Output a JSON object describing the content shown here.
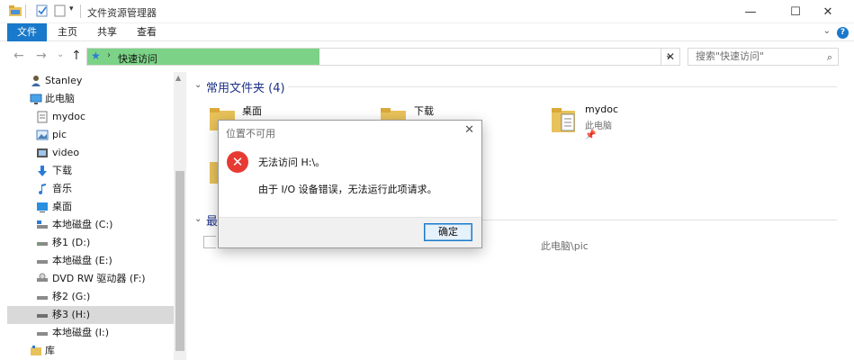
{
  "window": {
    "title": "文件资源管理器",
    "minimize": "—",
    "maximize": "☐",
    "close": "✕"
  },
  "ribbon": {
    "tabs": [
      "文件",
      "主页",
      "共享",
      "查看"
    ],
    "collapse": "⌄",
    "help": "?"
  },
  "nav": {
    "back": "←",
    "forward": "→",
    "recent": "⌄",
    "up": "↑"
  },
  "address": {
    "path": "快速访问",
    "separator": "›",
    "dropdown": "⌄",
    "clear": "✕"
  },
  "search": {
    "placeholder": "搜索\"快速访问\"",
    "icon": "⌕"
  },
  "sidebar": {
    "items": [
      {
        "label": "Stanley",
        "icon": "user-icon"
      },
      {
        "label": "此电脑",
        "icon": "computer-icon"
      },
      {
        "label": "mydoc",
        "icon": "document-icon"
      },
      {
        "label": "pic",
        "icon": "picture-icon"
      },
      {
        "label": "video",
        "icon": "video-icon"
      },
      {
        "label": "下载",
        "icon": "download-icon"
      },
      {
        "label": "音乐",
        "icon": "music-icon"
      },
      {
        "label": "桌面",
        "icon": "desktop-icon"
      },
      {
        "label": "本地磁盘 (C:)",
        "icon": "drive-c-icon"
      },
      {
        "label": "移1 (D:)",
        "icon": "drive-icon"
      },
      {
        "label": "本地磁盘 (E:)",
        "icon": "drive-icon"
      },
      {
        "label": "DVD RW 驱动器 (F:)",
        "icon": "dvd-drive-icon"
      },
      {
        "label": "移2 (G:)",
        "icon": "drive-icon"
      },
      {
        "label": "移3 (H:)",
        "icon": "drive-icon"
      },
      {
        "label": "本地磁盘 (I:)",
        "icon": "drive-icon"
      },
      {
        "label": "库",
        "icon": "library-icon"
      }
    ],
    "selected_index": 13
  },
  "main": {
    "frequent_folders": {
      "heading": "常用文件夹 (4)",
      "folders": [
        {
          "name": "桌面",
          "sub": "",
          "pinned": true
        },
        {
          "name": "下载",
          "sub": "",
          "pinned": true
        },
        {
          "name": "mydoc",
          "sub": "此电脑",
          "pinned": true
        },
        {
          "name": "",
          "sub": "",
          "pinned": true
        }
      ]
    },
    "recent": {
      "heading": "最",
      "item_path": "此电脑\\pic"
    }
  },
  "dialog": {
    "title": "位置不可用",
    "close": "✕",
    "error_icon": "✕",
    "message": "无法访问 H:\\。",
    "detail": "由于 I/O 设备错误，无法运行此项请求。",
    "ok_label": "确定"
  },
  "colors": {
    "accent": "#1979ca",
    "address_highlight": "#7cd387",
    "error": "#e63a33",
    "section_heading": "#1e3287",
    "folder": "#e8c25a"
  }
}
